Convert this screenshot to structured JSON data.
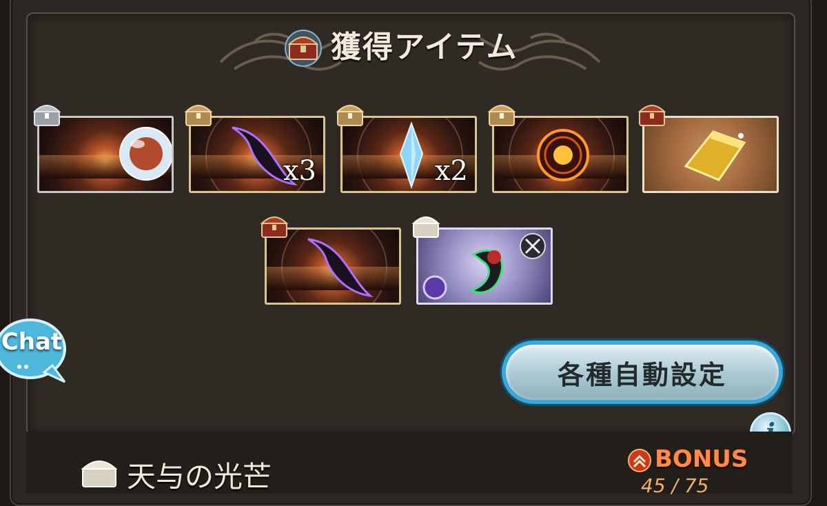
{
  "header": {
    "title": "獲得アイテム"
  },
  "items_row1": [
    {
      "name": "orb",
      "quantity": "",
      "badge": "silver-chest",
      "style": "silver"
    },
    {
      "name": "dark-horn",
      "quantity": "x3",
      "badge": "gold-chest",
      "style": "gold"
    },
    {
      "name": "crystal",
      "quantity": "x2",
      "badge": "gold-chest",
      "style": "gold"
    },
    {
      "name": "fire-orb",
      "quantity": "",
      "badge": "gold-chest",
      "style": "gold"
    },
    {
      "name": "gold-bar",
      "quantity": "",
      "badge": "red-chest",
      "style": "gold-bg"
    }
  ],
  "items_row2": [
    {
      "name": "dark-horn",
      "quantity": "",
      "badge": "red-chest",
      "style": "gold"
    },
    {
      "name": "weapon-sword",
      "quantity": "",
      "badge": "white-chest",
      "style": "purple-bg"
    }
  ],
  "chat": {
    "label": "Chat"
  },
  "auto_settings_button": {
    "label": "各種自動設定"
  },
  "info_button": {
    "label": "i"
  },
  "lower_section": {
    "title": "天与の光芒",
    "bonus_label": "BONUS",
    "bonus_count": "45 / 75"
  },
  "colors": {
    "accent_blue": "#3aa7d6",
    "frame_gold": "#d9c790",
    "bonus_orange": "#ff8a4a",
    "panel_bg": "#2f2a24"
  }
}
